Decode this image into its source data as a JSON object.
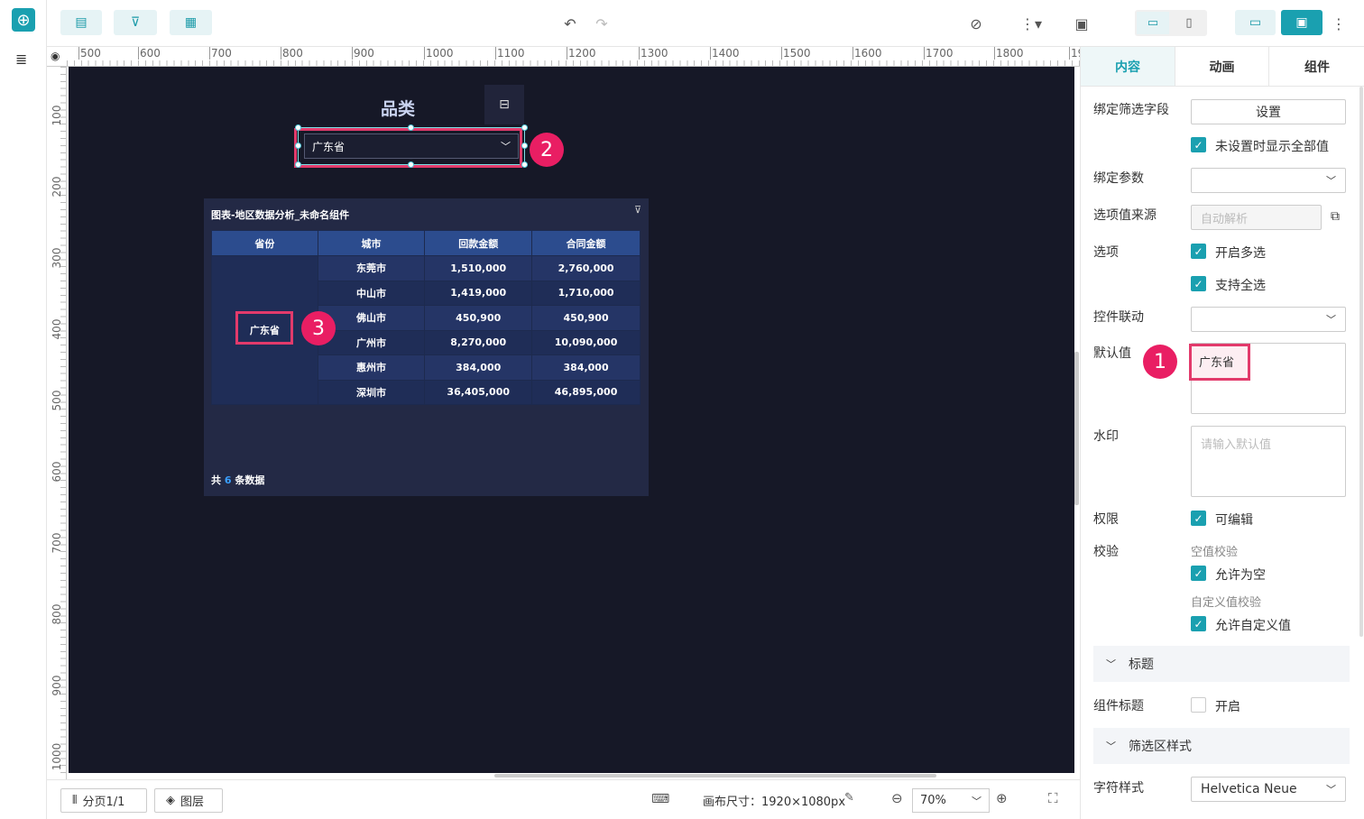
{
  "toolbar": {
    "zoom": "70%",
    "canvas_size": "画布尺寸：1920×1080px",
    "page": "分页1/1",
    "layers": "图层"
  },
  "ruler": {
    "h": [
      "500",
      "600",
      "700",
      "800",
      "900",
      "1000",
      "1100",
      "1200",
      "1300",
      "1400",
      "1500",
      "1600",
      "1700",
      "1800",
      "19"
    ],
    "v": [
      "100",
      "200",
      "300",
      "400",
      "500",
      "600",
      "700",
      "800",
      "900",
      "1000"
    ]
  },
  "canvas": {
    "filter_title": "品类",
    "filter_value": "广东省",
    "table_title": "图表-地区数据分析_未命名组件",
    "columns": [
      "省份",
      "城市",
      "回款金额",
      "合同金额"
    ],
    "province": "广东省",
    "rows": [
      [
        "东莞市",
        "1,510,000",
        "2,760,000"
      ],
      [
        "中山市",
        "1,419,000",
        "1,710,000"
      ],
      [
        "佛山市",
        "450,900",
        "450,900"
      ],
      [
        "广州市",
        "8,270,000",
        "10,090,000"
      ],
      [
        "惠州市",
        "384,000",
        "384,000"
      ],
      [
        "深圳市",
        "36,405,000",
        "46,895,000"
      ]
    ],
    "footer_prefix": "共",
    "footer_count": "6",
    "footer_suffix": "条数据"
  },
  "badges": {
    "b1": "1",
    "b2": "2",
    "b3": "3"
  },
  "panel": {
    "tabs": [
      "内容",
      "动画",
      "组件"
    ],
    "bind_field": "绑定筛选字段",
    "set_button": "设置",
    "show_all_unset": "未设置时显示全部值",
    "bind_param": "绑定参数",
    "option_source": "选项值来源",
    "auto_parse": "自动解析",
    "options": "选项",
    "multi_select": "开启多选",
    "select_all": "支持全选",
    "linkage": "控件联动",
    "default_value_label": "默认值",
    "default_value": "广东省",
    "watermark": "水印",
    "watermark_placeholder": "请输入默认值",
    "permission": "权限",
    "editable": "可编辑",
    "validation": "校验",
    "null_check": "空值校验",
    "allow_null": "允许为空",
    "custom_check": "自定义值校验",
    "allow_custom": "允许自定义值",
    "section_title": "标题",
    "component_title": "组件标题",
    "enable": "开启",
    "section_filter_style": "筛选区样式",
    "font_style": "字符样式",
    "font_value": "Helvetica Neue"
  },
  "colors": {
    "accent": "#1aa0b0",
    "badge": "#e91e63",
    "canvas": "#161827"
  }
}
